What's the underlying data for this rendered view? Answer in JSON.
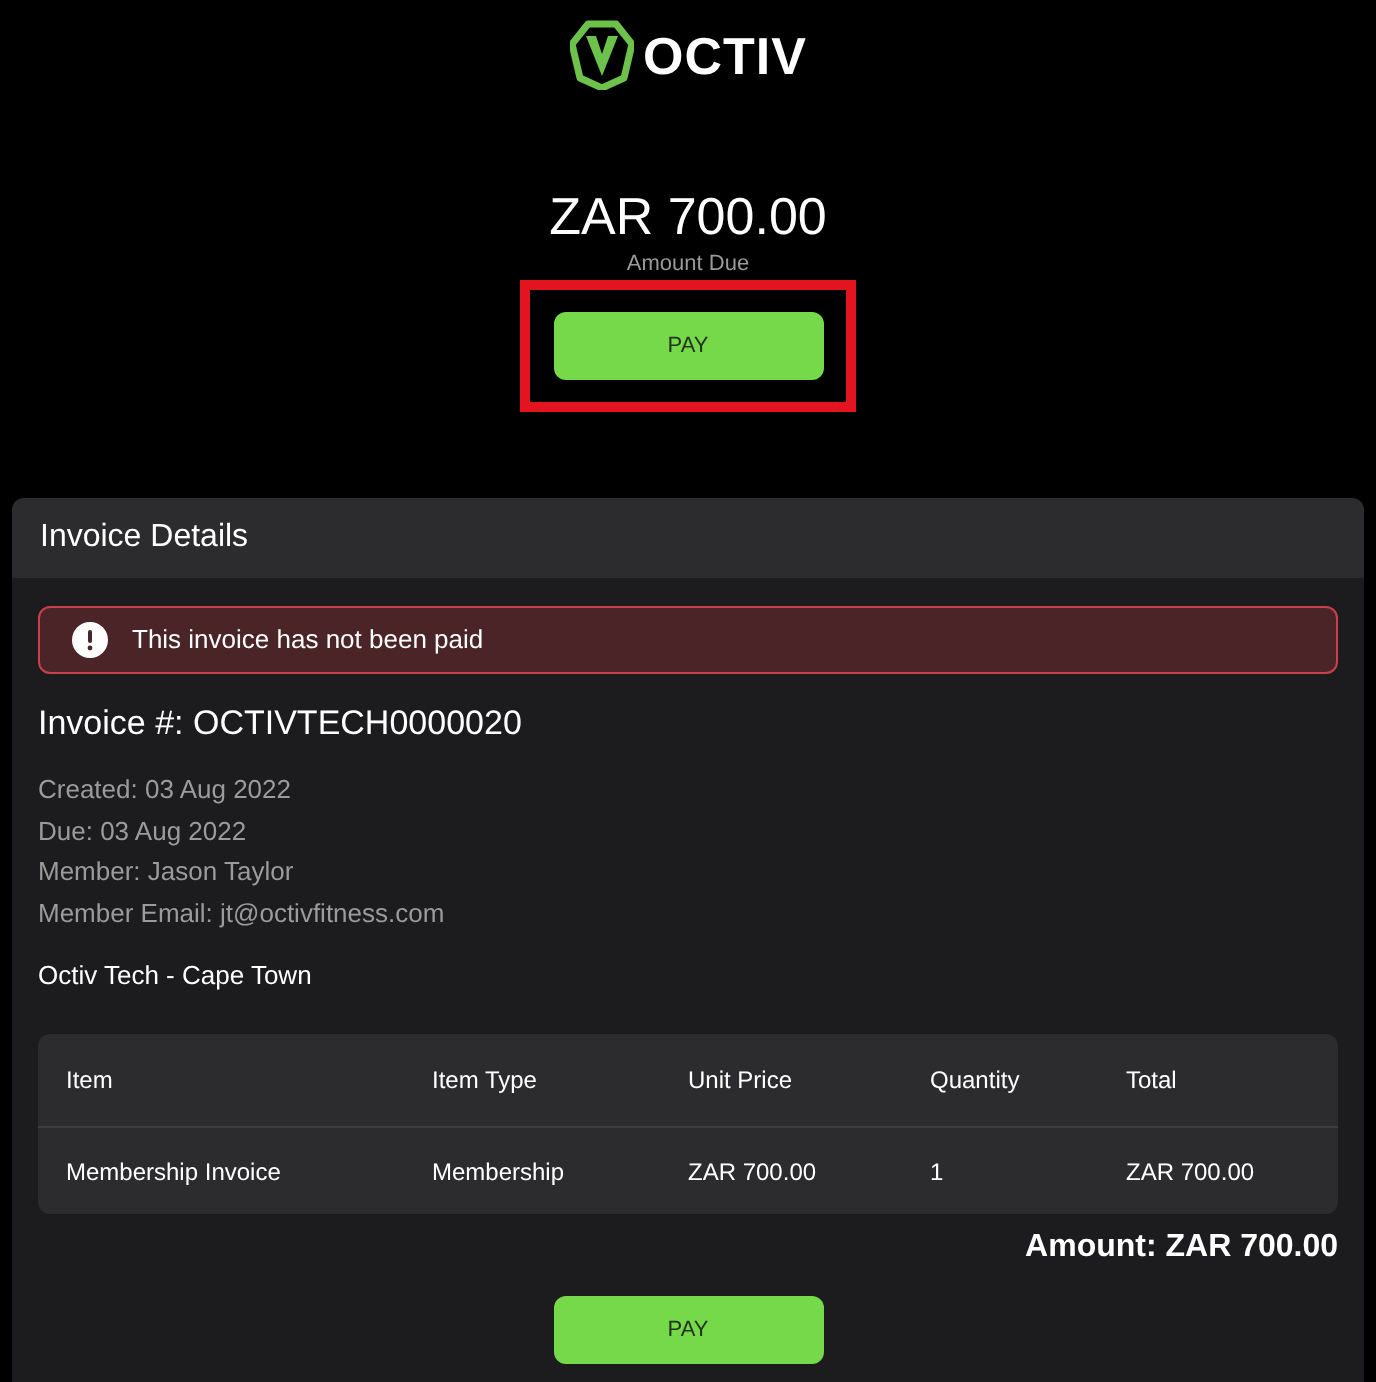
{
  "logo": {
    "text": "OCTIV"
  },
  "summary": {
    "amount": "ZAR 700.00",
    "label": "Amount Due",
    "pay_button": {
      "label": "PAY",
      "highlighted": true
    }
  },
  "invoice_card": {
    "title": "Invoice Details",
    "alert": {
      "text": "This invoice has not been paid"
    },
    "invoice_number": "Invoice #: OCTIVTECH0000020",
    "details": [
      "Created: 03 Aug 2022",
      "Due: 03 Aug 2022",
      "Member: Jason Taylor",
      "Member Email: jt@octivfitness.com"
    ],
    "location": "Octiv Tech - Cape Town",
    "table": {
      "columns": [
        "Item",
        "Item Type",
        "Unit Price",
        "Quantity",
        "Total"
      ],
      "rows": [
        [
          "Membership Invoice",
          "Membership",
          "ZAR 700.00",
          "1",
          "ZAR 700.00"
        ]
      ]
    },
    "total": "Amount: ZAR 700.00",
    "pay_button": {
      "label": "PAY"
    }
  }
}
